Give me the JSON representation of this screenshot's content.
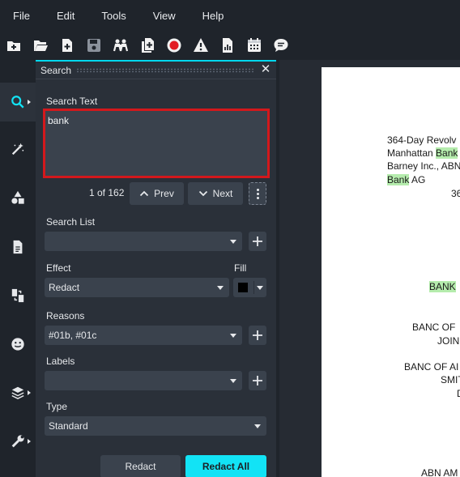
{
  "menu": {
    "file": "File",
    "edit": "Edit",
    "tools": "Tools",
    "view": "View",
    "help": "Help"
  },
  "panel": {
    "title": "Search",
    "search_text_label": "Search Text",
    "search_value": "bank",
    "result_count": "1 of 162",
    "prev_label": "Prev",
    "next_label": "Next",
    "search_list_label": "Search List",
    "search_list_value": "",
    "effect_label": "Effect",
    "effect_value": "Redact",
    "fill_label": "Fill",
    "fill_color": "#000000",
    "reasons_label": "Reasons",
    "reasons_value": "#01b, #01c",
    "labels_label": "Labels",
    "labels_value": "",
    "type_label": "Type",
    "type_value": "Standard",
    "redact_label": "Redact",
    "redact_all_label": "Redact All"
  },
  "document": {
    "line1": "364-Day Revolv",
    "line2_pre": "Manhattan ",
    "line2_hl": "Bank",
    "line3": "Barney Inc., ABN",
    "line4_hl": "Bank",
    "line4_post": " AG",
    "line5": "36",
    "line6_hl": "BANK",
    "line7": "BANC OF",
    "line8": "JOIN",
    "line9": "BANC OF AI",
    "line10": "SMIT",
    "line11": "D",
    "line12": "ABN AM"
  },
  "colors": {
    "accent": "#12e3f5",
    "highlight_box": "#d3181c",
    "search_highlight": "#b5ecad"
  }
}
